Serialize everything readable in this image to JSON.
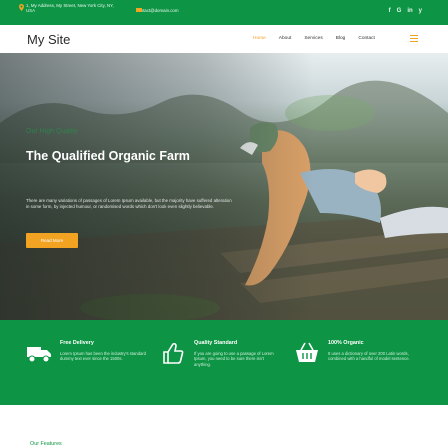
{
  "topbar": {
    "address": "1, My Address, My Street, New York City, NY, USA",
    "email": "contact@domain.com",
    "social": [
      "f",
      "G",
      "in",
      "y"
    ]
  },
  "nav": {
    "brand": "My Site",
    "menu": [
      "Home",
      "About",
      "Services",
      "Blog",
      "Contact"
    ],
    "active": "Home"
  },
  "hero": {
    "kicker": "Our High Quality",
    "title": "The Qualified Organic Farm",
    "description": "There are many variations of passages of Lorem Ipsum available, but the majority have suffered alteration in some form, by injected humour, or randomised words which don't look even slightly believable.",
    "button": "Read More"
  },
  "features": [
    {
      "title": "Free Delivery",
      "description": "Lorem Ipsum has been the industry's standard dummy text ever since the 1500s.",
      "icon": "truck-icon"
    },
    {
      "title": "Quality Standard",
      "description": "If you are going to use a passage of Lorem Ipsum, you need to be sure there isn't anything.",
      "icon": "thumbs-up-icon"
    },
    {
      "title": "100% Organic",
      "description": "It uses a dictionary of over 200 Latin words, combined with a handful of model sentence.",
      "icon": "basket-icon"
    }
  ],
  "section": {
    "heading": "Our Features"
  },
  "colors": {
    "brand_green": "#0d9444",
    "accent_orange": "#f2a321"
  }
}
